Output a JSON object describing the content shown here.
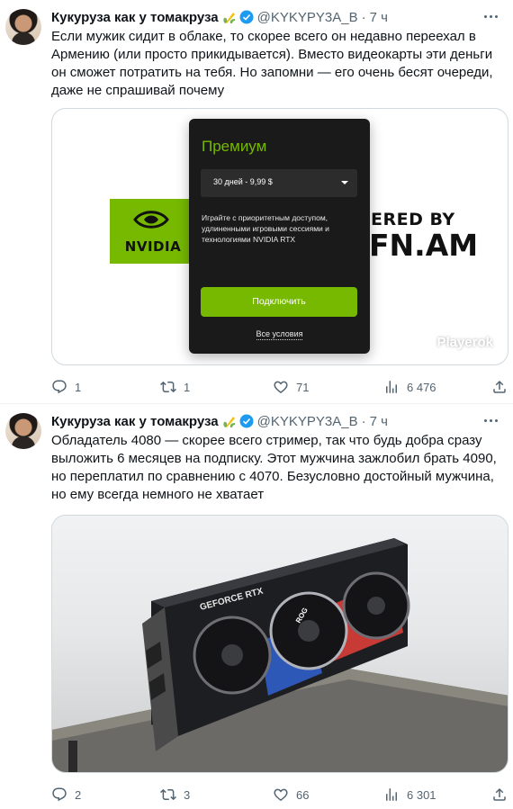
{
  "tweets": [
    {
      "author": "Кукуруза как у томакруза",
      "handle": "@KYKYPY3A_B",
      "separator": "·",
      "time": "7 ч",
      "text": "Если мужик сидит в облаке, то скорее всего он недавно переехал в\nАрмению (или просто прикидывается). Вместо видеокарты эти деньги\nон сможет потратить на тебя. Но запомни — его очень бесят очереди,\nдаже не спрашивай почему",
      "media": {
        "logo_text": "NVIDIA",
        "powered_text": "ERED BY",
        "brand_text": "FN.AM",
        "watermark": "Playerok",
        "card": {
          "title": "Премиум",
          "period": "30 дней - 9,99 $",
          "description": "Играйте с приоритетным доступом,\nудлиненными игровыми сессиями и\nтехнологиями NVIDIA RTX",
          "button": "Подключить",
          "terms": "Все условия"
        }
      },
      "stats": {
        "replies": "1",
        "retweets": "1",
        "likes": "71",
        "views": "6 476"
      }
    },
    {
      "author": "Кукуруза как у томакруза",
      "handle": "@KYKYPY3A_B",
      "separator": "·",
      "time": "7 ч",
      "text": "Обладатель 4080 — скорее всего стример, так что будь добра сразу\nвыложить 6 месяцев на подписку. Этот мужчина зажлобил брать 4090,\nно переплатил по сравнению с 4070. Безусловно достойный мужчина,\nно ему всегда немного не хватает",
      "media": {
        "card_label": "GEFORCE RTX",
        "brand_label": "ROG"
      },
      "stats": {
        "replies": "2",
        "retweets": "3",
        "likes": "66",
        "views": "6 301"
      }
    }
  ],
  "colors": {
    "nvidia_green": "#76b900",
    "text_primary": "#0f1419",
    "text_secondary": "#536471",
    "verified_blue": "#1d9bf0"
  }
}
